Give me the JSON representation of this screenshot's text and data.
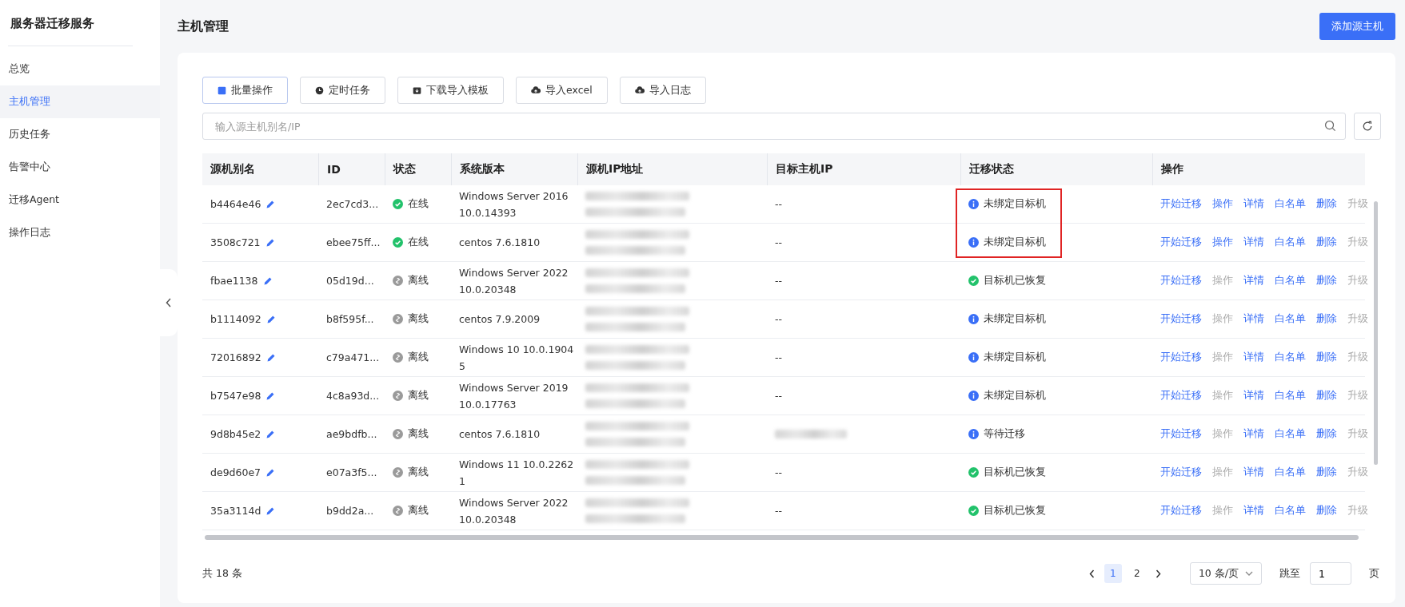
{
  "sidebar": {
    "title": "服务器迁移服务",
    "items": [
      {
        "label": "总览",
        "selected": false
      },
      {
        "label": "主机管理",
        "selected": true
      },
      {
        "label": "历史任务",
        "selected": false
      },
      {
        "label": "告警中心",
        "selected": false
      },
      {
        "label": "迁移Agent",
        "selected": false
      },
      {
        "label": "操作日志",
        "selected": false
      }
    ]
  },
  "header": {
    "title": "主机管理",
    "primary_button": "添加源主机"
  },
  "toolbar": [
    {
      "label": "批量操作",
      "kind": "batch",
      "selected": true
    },
    {
      "label": "定时任务",
      "kind": "timer",
      "selected": false
    },
    {
      "label": "下载导入模板",
      "kind": "download",
      "selected": false
    },
    {
      "label": "导入excel",
      "kind": "upload",
      "selected": false
    },
    {
      "label": "导入日志",
      "kind": "upload",
      "selected": false
    }
  ],
  "search": {
    "placeholder": "输入源主机别名/IP"
  },
  "table": {
    "columns": [
      "源机别名",
      "ID",
      "状态",
      "系统版本",
      "源机IP地址",
      "目标主机IP",
      "迁移状态",
      "操作"
    ],
    "rows": [
      {
        "alias": "b4464e46",
        "id": "2ec7cd3...",
        "status": {
          "kind": "online",
          "text": "在线"
        },
        "os": "Windows Server 2016 10.0.14393",
        "source_ip": {
          "kind": "redacted"
        },
        "target_ip": {
          "kind": "text",
          "text": "--"
        },
        "migration": {
          "kind": "info",
          "text": "未绑定目标机",
          "highlighted": true
        },
        "actions": [
          {
            "label": "开始迁移",
            "disabled": false
          },
          {
            "label": "操作",
            "disabled": false
          },
          {
            "label": "详情",
            "disabled": false
          },
          {
            "label": "白名单",
            "disabled": false
          },
          {
            "label": "删除",
            "disabled": false
          },
          {
            "label": "升级",
            "disabled": true
          }
        ]
      },
      {
        "alias": "3508c721",
        "id": "ebee75ff...",
        "status": {
          "kind": "online",
          "text": "在线"
        },
        "os": "centos 7.6.1810",
        "source_ip": {
          "kind": "redacted"
        },
        "target_ip": {
          "kind": "text",
          "text": "--"
        },
        "migration": {
          "kind": "info",
          "text": "未绑定目标机",
          "highlighted": true
        },
        "actions": [
          {
            "label": "开始迁移",
            "disabled": false
          },
          {
            "label": "操作",
            "disabled": false
          },
          {
            "label": "详情",
            "disabled": false
          },
          {
            "label": "白名单",
            "disabled": false
          },
          {
            "label": "删除",
            "disabled": false
          },
          {
            "label": "升级",
            "disabled": true
          }
        ]
      },
      {
        "alias": "fbae1138",
        "id": "05d19d...",
        "status": {
          "kind": "offline",
          "text": "离线"
        },
        "os": "Windows Server 2022 10.0.20348",
        "source_ip": {
          "kind": "redacted"
        },
        "target_ip": {
          "kind": "text",
          "text": "--"
        },
        "migration": {
          "kind": "success",
          "text": "目标机已恢复",
          "highlighted": false
        },
        "actions": [
          {
            "label": "开始迁移",
            "disabled": false
          },
          {
            "label": "操作",
            "disabled": true
          },
          {
            "label": "详情",
            "disabled": false
          },
          {
            "label": "白名单",
            "disabled": false
          },
          {
            "label": "删除",
            "disabled": false
          },
          {
            "label": "升级",
            "disabled": true
          }
        ]
      },
      {
        "alias": "b1114092",
        "id": "b8f595f...",
        "status": {
          "kind": "offline",
          "text": "离线"
        },
        "os": "centos 7.9.2009",
        "source_ip": {
          "kind": "redacted"
        },
        "target_ip": {
          "kind": "text",
          "text": "--"
        },
        "migration": {
          "kind": "info",
          "text": "未绑定目标机",
          "highlighted": false
        },
        "actions": [
          {
            "label": "开始迁移",
            "disabled": false
          },
          {
            "label": "操作",
            "disabled": true
          },
          {
            "label": "详情",
            "disabled": false
          },
          {
            "label": "白名单",
            "disabled": false
          },
          {
            "label": "删除",
            "disabled": false
          },
          {
            "label": "升级",
            "disabled": true
          }
        ]
      },
      {
        "alias": "72016892",
        "id": "c79a471...",
        "status": {
          "kind": "offline",
          "text": "离线"
        },
        "os": "Windows 10 10.0.19045",
        "source_ip": {
          "kind": "redacted"
        },
        "target_ip": {
          "kind": "text",
          "text": "--"
        },
        "migration": {
          "kind": "info",
          "text": "未绑定目标机",
          "highlighted": false
        },
        "actions": [
          {
            "label": "开始迁移",
            "disabled": false
          },
          {
            "label": "操作",
            "disabled": true
          },
          {
            "label": "详情",
            "disabled": false
          },
          {
            "label": "白名单",
            "disabled": false
          },
          {
            "label": "删除",
            "disabled": false
          },
          {
            "label": "升级",
            "disabled": true
          }
        ]
      },
      {
        "alias": "b7547e98",
        "id": "4c8a93d...",
        "status": {
          "kind": "offline",
          "text": "离线"
        },
        "os": "Windows Server 2019 10.0.17763",
        "source_ip": {
          "kind": "redacted"
        },
        "target_ip": {
          "kind": "text",
          "text": "--"
        },
        "migration": {
          "kind": "info",
          "text": "未绑定目标机",
          "highlighted": false
        },
        "actions": [
          {
            "label": "开始迁移",
            "disabled": false
          },
          {
            "label": "操作",
            "disabled": true
          },
          {
            "label": "详情",
            "disabled": false
          },
          {
            "label": "白名单",
            "disabled": false
          },
          {
            "label": "删除",
            "disabled": false
          },
          {
            "label": "升级",
            "disabled": true
          }
        ]
      },
      {
        "alias": "9d8b45e2",
        "id": "ae9bdfb...",
        "status": {
          "kind": "offline",
          "text": "离线"
        },
        "os": "centos 7.6.1810",
        "source_ip": {
          "kind": "redacted"
        },
        "target_ip": {
          "kind": "redacted"
        },
        "migration": {
          "kind": "info",
          "text": "等待迁移",
          "highlighted": false
        },
        "actions": [
          {
            "label": "开始迁移",
            "disabled": false
          },
          {
            "label": "操作",
            "disabled": true
          },
          {
            "label": "详情",
            "disabled": false
          },
          {
            "label": "白名单",
            "disabled": false
          },
          {
            "label": "删除",
            "disabled": false
          },
          {
            "label": "升级",
            "disabled": true
          }
        ]
      },
      {
        "alias": "de9d60e7",
        "id": "e07a3f5...",
        "status": {
          "kind": "offline",
          "text": "离线"
        },
        "os": "Windows 11 10.0.22621",
        "source_ip": {
          "kind": "redacted"
        },
        "target_ip": {
          "kind": "text",
          "text": "--"
        },
        "migration": {
          "kind": "success",
          "text": "目标机已恢复",
          "highlighted": false
        },
        "actions": [
          {
            "label": "开始迁移",
            "disabled": false
          },
          {
            "label": "操作",
            "disabled": true
          },
          {
            "label": "详情",
            "disabled": false
          },
          {
            "label": "白名单",
            "disabled": false
          },
          {
            "label": "删除",
            "disabled": false
          },
          {
            "label": "升级",
            "disabled": true
          }
        ]
      },
      {
        "alias": "35a3114d",
        "id": "b9dd2a...",
        "status": {
          "kind": "offline",
          "text": "离线"
        },
        "os": "Windows Server 2022 10.0.20348",
        "source_ip": {
          "kind": "redacted"
        },
        "target_ip": {
          "kind": "text",
          "text": "--"
        },
        "migration": {
          "kind": "success",
          "text": "目标机已恢复",
          "highlighted": false
        },
        "actions": [
          {
            "label": "开始迁移",
            "disabled": false
          },
          {
            "label": "操作",
            "disabled": true
          },
          {
            "label": "详情",
            "disabled": false
          },
          {
            "label": "白名单",
            "disabled": false
          },
          {
            "label": "删除",
            "disabled": false
          },
          {
            "label": "升级",
            "disabled": true
          }
        ]
      }
    ]
  },
  "footer": {
    "total": "共 18 条",
    "pages": [
      {
        "label": "1",
        "selected": true
      },
      {
        "label": "2",
        "selected": false
      }
    ],
    "page_size": "10 条/页",
    "jump_label": "跳至",
    "jump_value": "1",
    "jump_suffix": "页"
  }
}
